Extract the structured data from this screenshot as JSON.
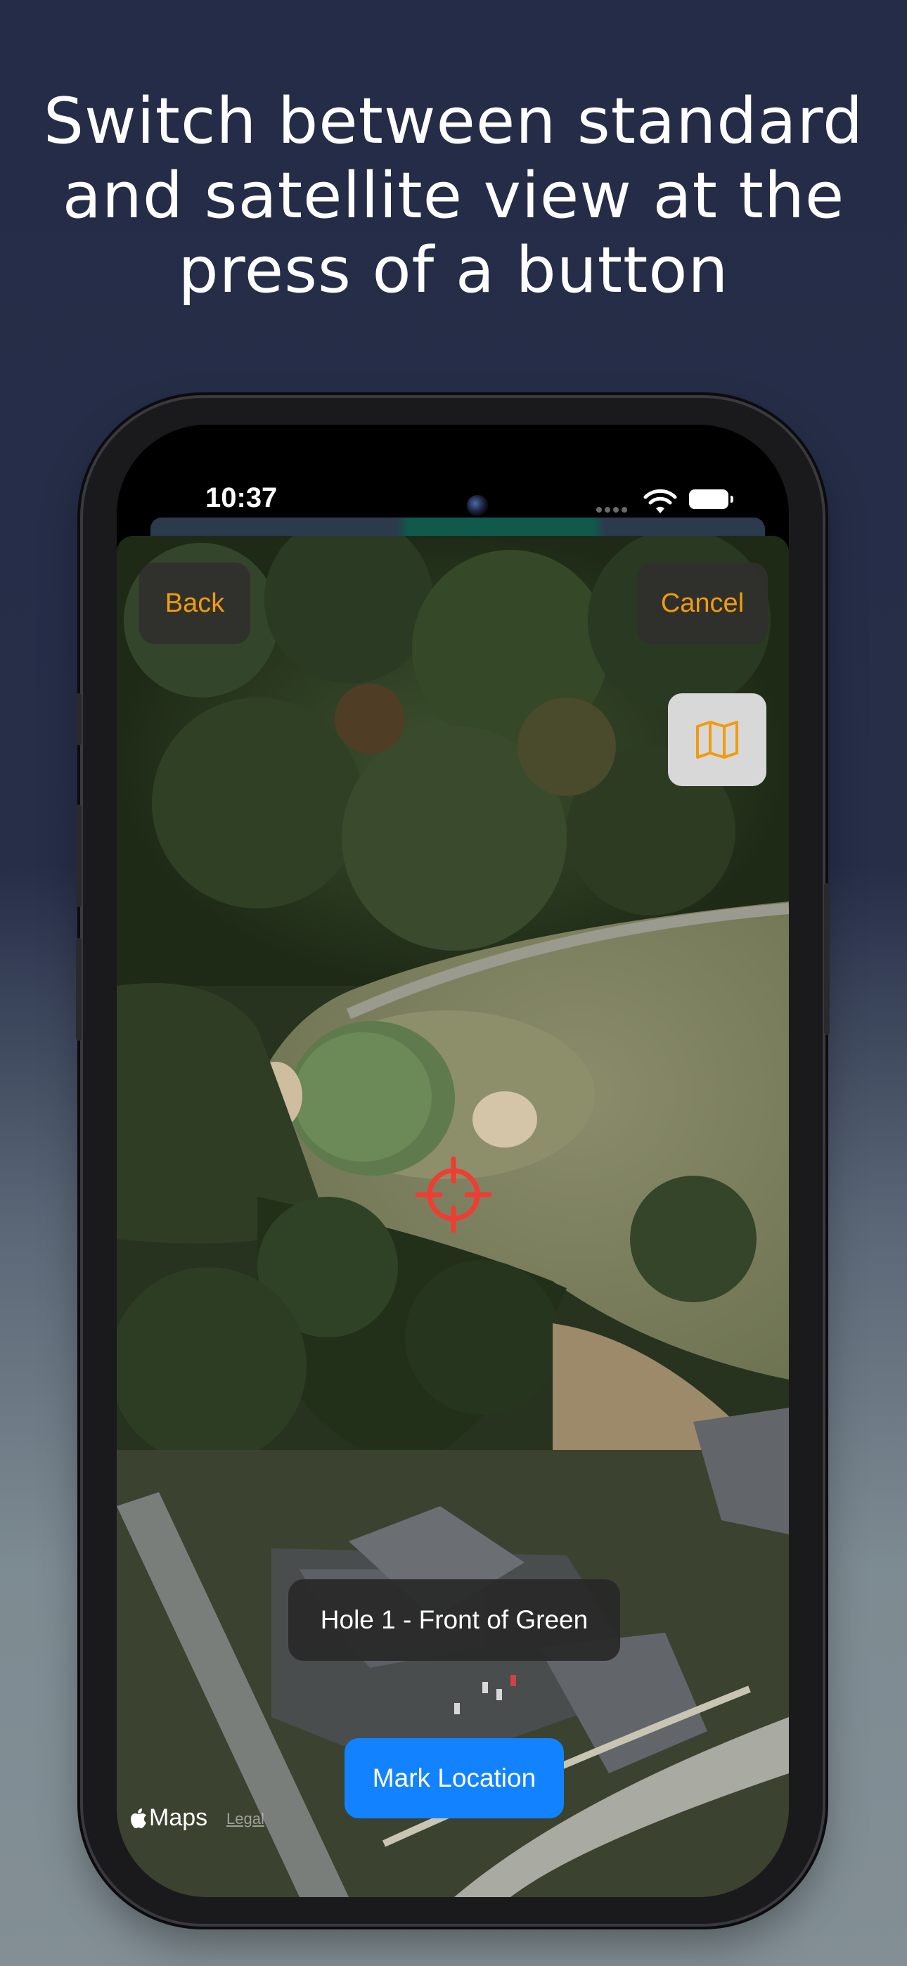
{
  "headline": {
    "line1": "Switch between standard",
    "line2": "and satellite view at the",
    "line3": "press of a button"
  },
  "status_bar": {
    "time": "10:37",
    "icons": [
      "camera-icon",
      "wifi-icon",
      "battery-icon"
    ]
  },
  "map_screen": {
    "back_label": "Back",
    "cancel_label": "Cancel",
    "map_toggle_icon": "map-icon",
    "crosshair_icon": "crosshair-icon",
    "location_label": "Hole 1 - Front of Green",
    "mark_button_label": "Mark Location",
    "attribution": "Maps",
    "legal_label": "Legal"
  },
  "colors": {
    "accent_orange": "#f19b0f",
    "primary_blue": "#1282ff",
    "crosshair_red": "#f03c32",
    "background_top": "#252c47",
    "background_bottom": "#838f95"
  }
}
